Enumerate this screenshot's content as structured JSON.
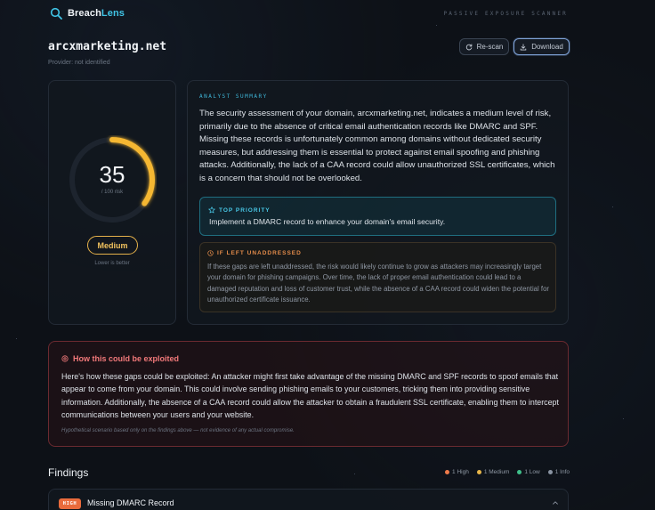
{
  "brand": {
    "name_main": "Breach",
    "name_accent": "Lens",
    "tagline": "PASSIVE EXPOSURE SCANNER"
  },
  "header": {
    "domain": "arcxmarketing.net",
    "provider": "Provider: not identified",
    "rescan_label": "Re-scan",
    "download_label": "Download"
  },
  "score": {
    "value": "35",
    "max_label": "/ 100 risk",
    "fraction": 0.35,
    "level": "Medium",
    "hint": "Lower is better"
  },
  "summary": {
    "label": "ANALYST SUMMARY",
    "text": "The security assessment of your domain, arcxmarketing.net, indicates a medium level of risk, primarily due to the absence of critical email authentication records like DMARC and SPF. Missing these records is unfortunately common among domains without dedicated security measures, but addressing them is essential to protect against email spoofing and phishing attacks. Additionally, the lack of a CAA record could allow unauthorized SSL certificates, which is a concern that should not be overlooked.",
    "priority_title": "TOP PRIORITY",
    "priority_text": "Implement a DMARC record to enhance your domain's email security.",
    "unaddressed_title": "IF LEFT UNADDRESSED",
    "unaddressed_text": "If these gaps are left unaddressed, the risk would likely continue to grow as attackers may increasingly target your domain for phishing campaigns. Over time, the lack of proper email authentication could lead to a damaged reputation and loss of customer trust, while the absence of a CAA record could widen the potential for unauthorized certificate issuance."
  },
  "exploit": {
    "title": "How this could be exploited",
    "text": "Here's how these gaps could be exploited: An attacker might first take advantage of the missing DMARC and SPF records to spoof emails that appear to come from your domain. This could involve sending phishing emails to your customers, tricking them into providing sensitive information. Additionally, the absence of a CAA record could allow the attacker to obtain a fraudulent SSL certificate, enabling them to intercept communications between your users and your website.",
    "note": "Hypothetical scenario based only on the findings above — not evidence of any actual compromise."
  },
  "findings": {
    "title": "Findings",
    "legend": [
      {
        "label": "1 High",
        "color": "#ef7a4a"
      },
      {
        "label": "1 Medium",
        "color": "#e8b64a"
      },
      {
        "label": "1 Low",
        "color": "#3fbf8a"
      },
      {
        "label": "1 Info",
        "color": "#8a94a3"
      }
    ],
    "items": [
      {
        "severity": "HIGH",
        "name": "Missing DMARC Record"
      }
    ]
  },
  "colors": {
    "accent": "#40c4e6",
    "gauge": "#f5b731",
    "danger": "#f2797a",
    "warning": "#e38b4a"
  }
}
